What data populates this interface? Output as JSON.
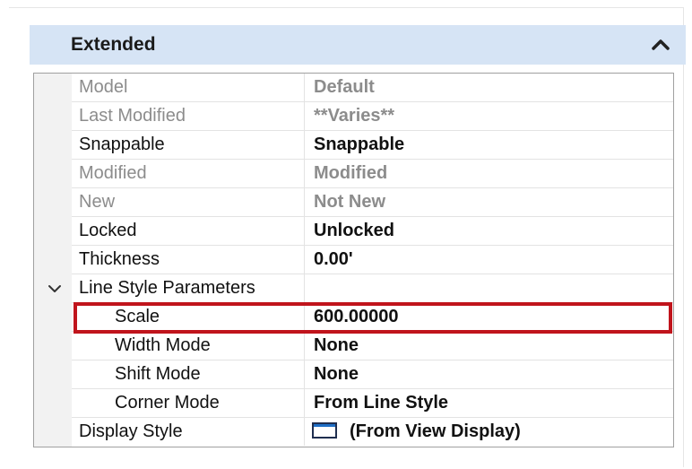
{
  "panel": {
    "title": "Extended",
    "collapse_icon": "chevron-up-icon"
  },
  "properties": [
    {
      "label": "Model",
      "value": "Default",
      "style": "dim"
    },
    {
      "label": "Last Modified",
      "value": "**Varies**",
      "style": "dim"
    },
    {
      "label": "Snappable",
      "value": "Snappable",
      "style": "dark"
    },
    {
      "label": "Modified",
      "value": "Modified",
      "style": "dim"
    },
    {
      "label": "New",
      "value": "Not New",
      "style": "dim"
    },
    {
      "label": "Locked",
      "value": "Unlocked",
      "style": "dark"
    },
    {
      "label": "Thickness",
      "value": "0.00'",
      "style": "dark"
    },
    {
      "label": "Line Style Parameters",
      "value": "",
      "style": "dark",
      "group": true,
      "expanded": true
    },
    {
      "label": "Scale",
      "value": "600.00000",
      "style": "dark",
      "child": true,
      "highlighted": true
    },
    {
      "label": "Width Mode",
      "value": "None",
      "style": "dark",
      "child": true
    },
    {
      "label": "Shift Mode",
      "value": "None",
      "style": "dark",
      "child": true
    },
    {
      "label": "Corner Mode",
      "value": "From Line Style",
      "style": "dark",
      "child": true
    },
    {
      "label": "Display Style",
      "value": "(From View Display)",
      "style": "dark",
      "icon": "display-style-swatch-icon"
    }
  ],
  "colors": {
    "header_bg": "#d6e4f5",
    "highlight_border": "#c0141c",
    "dim_text": "#8c8c8c"
  }
}
